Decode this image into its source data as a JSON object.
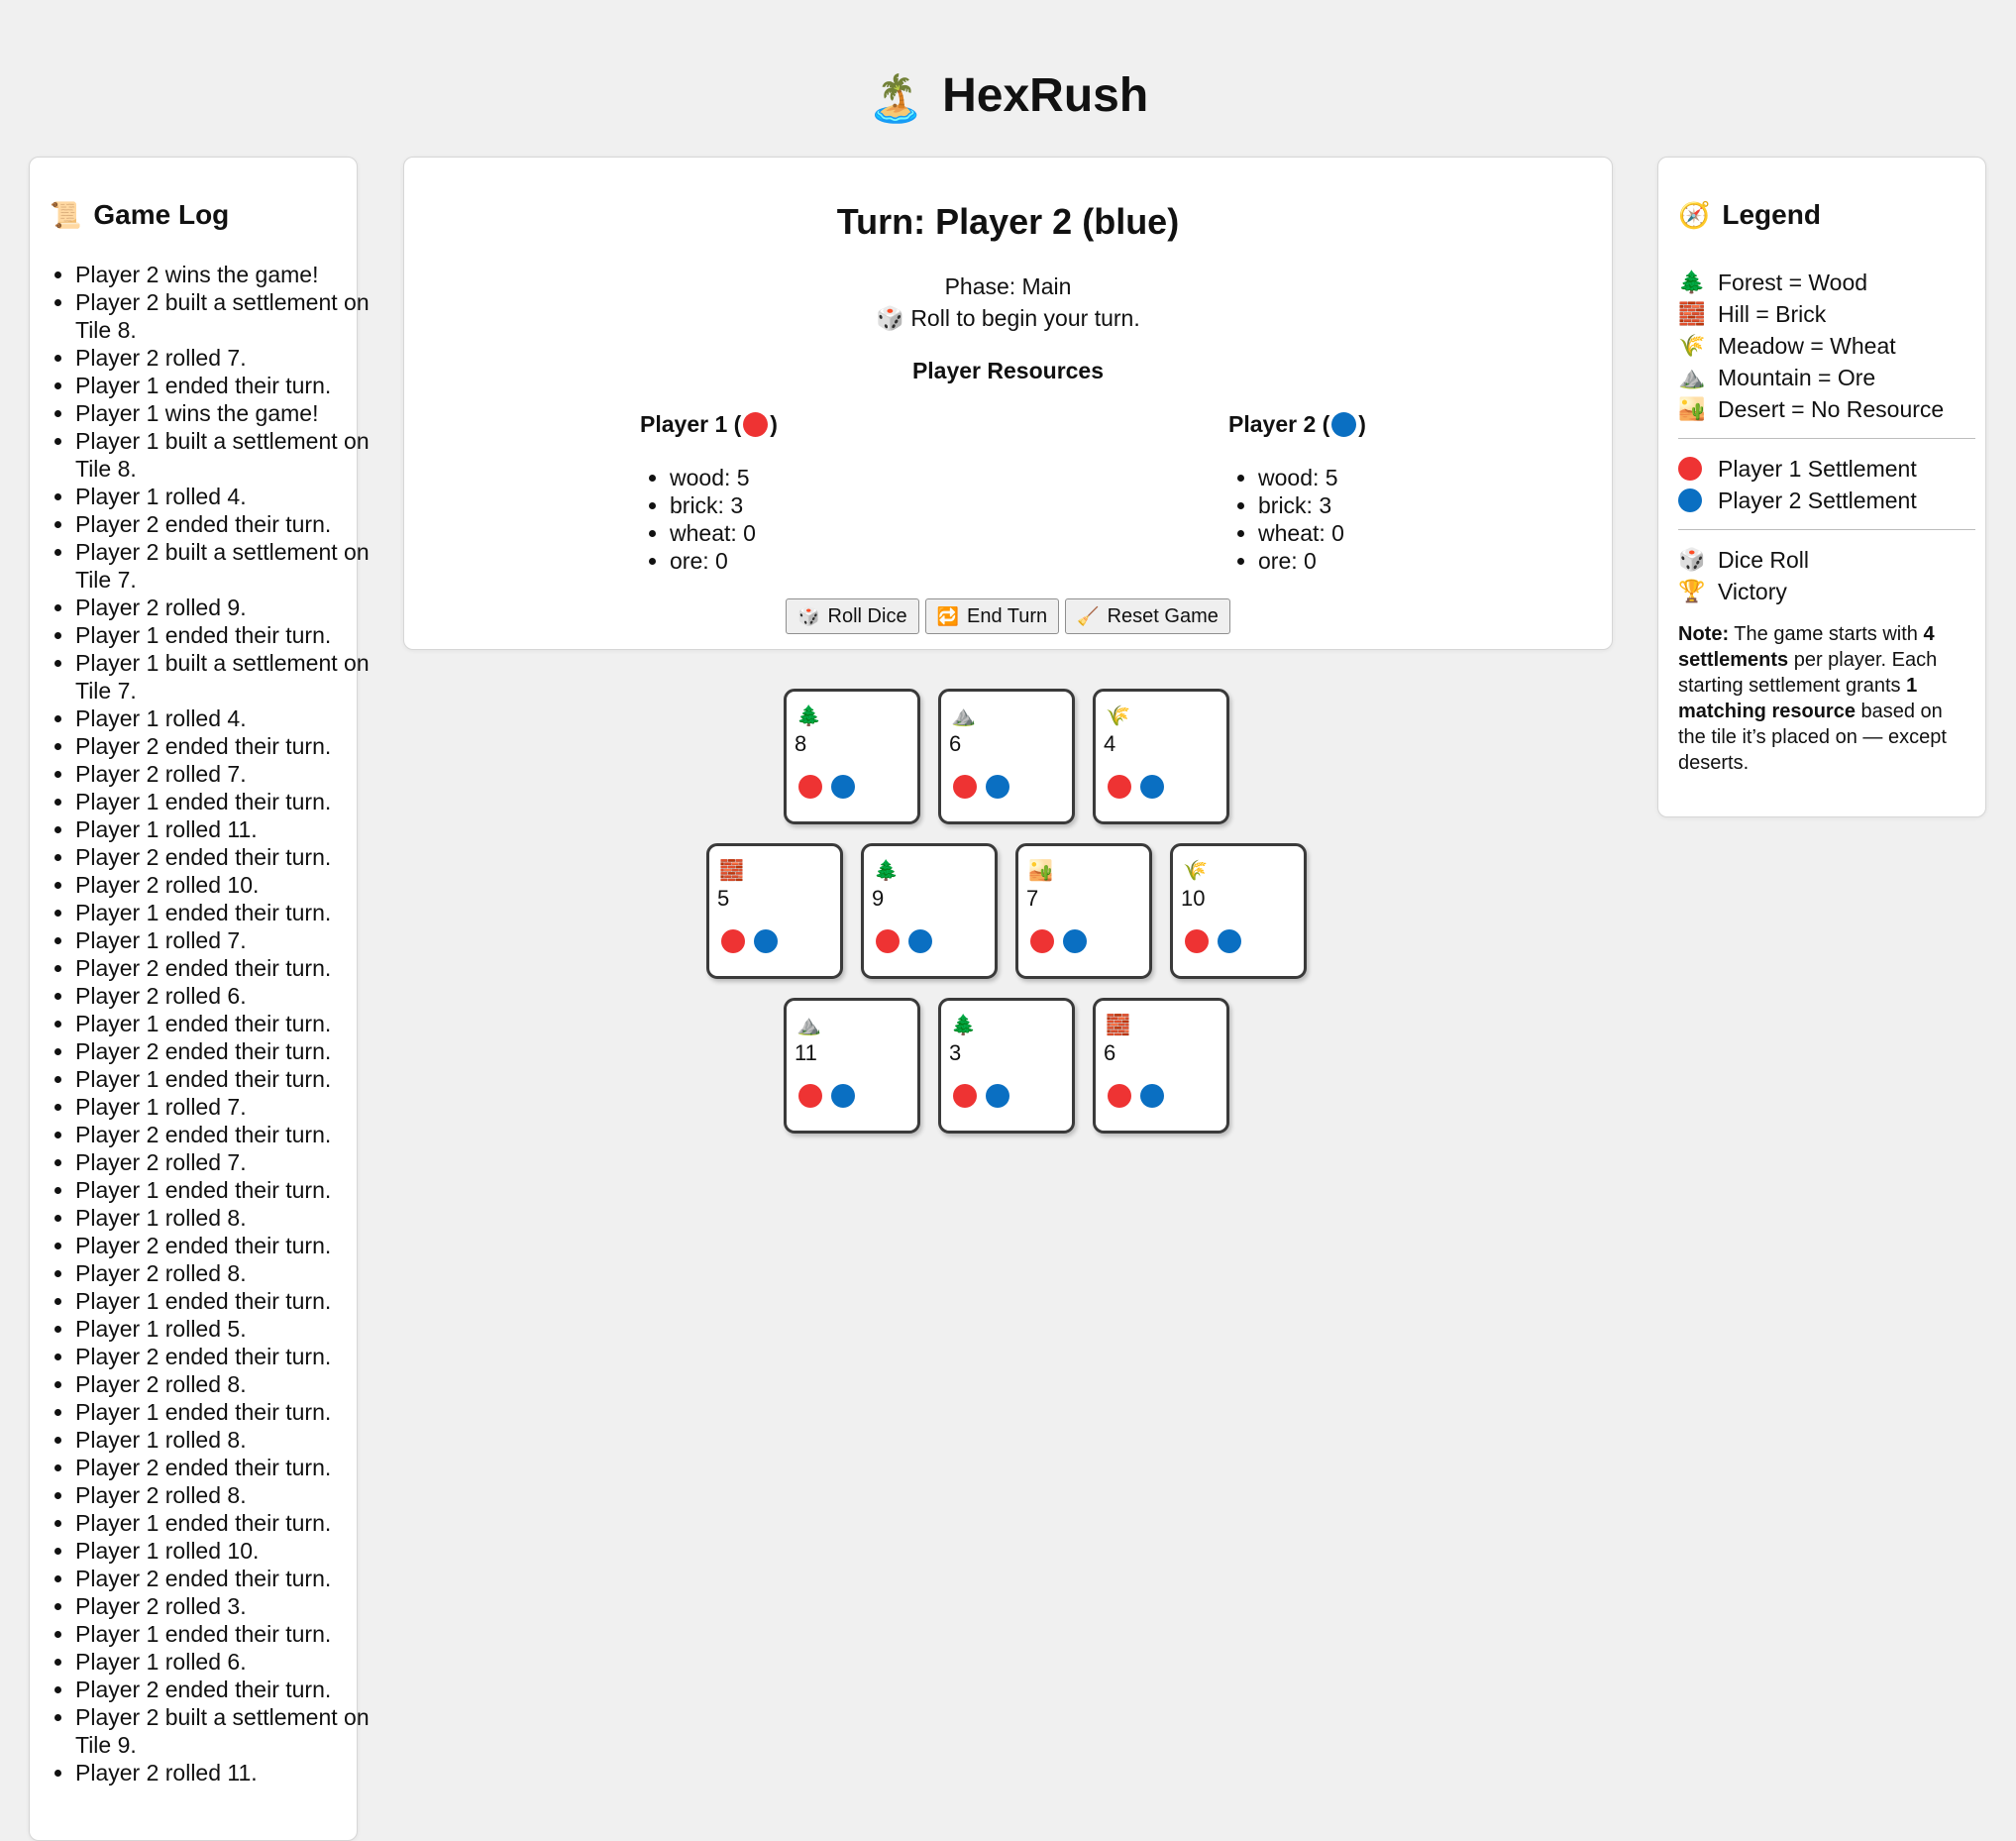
{
  "app": {
    "title": "HexRush",
    "title_icon": "🏝️"
  },
  "colors": {
    "player1": "#ee3333",
    "player2": "#0a6fc2"
  },
  "log": {
    "heading": "Game Log",
    "heading_icon": "📜",
    "entries": [
      "Player 2 wins the game!",
      "Player 2 built a settlement on Tile 8.",
      "Player 2 rolled 7.",
      "Player 1 ended their turn.",
      "Player 1 wins the game!",
      "Player 1 built a settlement on Tile 8.",
      "Player 1 rolled 4.",
      "Player 2 ended their turn.",
      "Player 2 built a settlement on Tile 7.",
      "Player 2 rolled 9.",
      "Player 1 ended their turn.",
      "Player 1 built a settlement on Tile 7.",
      "Player 1 rolled 4.",
      "Player 2 ended their turn.",
      "Player 2 rolled 7.",
      "Player 1 ended their turn.",
      "Player 1 rolled 11.",
      "Player 2 ended their turn.",
      "Player 2 rolled 10.",
      "Player 1 ended their turn.",
      "Player 1 rolled 7.",
      "Player 2 ended their turn.",
      "Player 2 rolled 6.",
      "Player 1 ended their turn.",
      "Player 2 ended their turn.",
      "Player 1 ended their turn.",
      "Player 1 rolled 7.",
      "Player 2 ended their turn.",
      "Player 2 rolled 7.",
      "Player 1 ended their turn.",
      "Player 1 rolled 8.",
      "Player 2 ended their turn.",
      "Player 2 rolled 8.",
      "Player 1 ended their turn.",
      "Player 1 rolled 5.",
      "Player 2 ended their turn.",
      "Player 2 rolled 8.",
      "Player 1 ended their turn.",
      "Player 1 rolled 8.",
      "Player 2 ended their turn.",
      "Player 2 rolled 8.",
      "Player 1 ended their turn.",
      "Player 1 rolled 10.",
      "Player 2 ended their turn.",
      "Player 2 rolled 3.",
      "Player 1 ended their turn.",
      "Player 1 rolled 6.",
      "Player 2 ended their turn.",
      "Player 2 built a settlement on Tile 9.",
      "Player 2 rolled 11."
    ]
  },
  "status": {
    "turn": "Turn: Player 2 (blue)",
    "phase": "Phase: Main",
    "hint_icon": "🎲",
    "hint": "Roll to begin your turn.",
    "resources_heading": "Player Resources",
    "players": [
      {
        "name": "Player 1 (",
        "close": ")",
        "resources": [
          "wood: 5",
          "brick: 3",
          "wheat: 0",
          "ore: 0"
        ]
      },
      {
        "name": "Player 2 (",
        "close": ")",
        "resources": [
          "wood: 5",
          "brick: 3",
          "wheat: 0",
          "ore: 0"
        ]
      }
    ],
    "buttons": {
      "roll": {
        "icon": "🎲",
        "label": "Roll Dice"
      },
      "end": {
        "icon": "🔁",
        "label": "End Turn"
      },
      "reset": {
        "icon": "🧹",
        "label": "Reset Game"
      }
    }
  },
  "legend": {
    "heading": "Legend",
    "heading_icon": "🧭",
    "terrain": [
      {
        "icon": "🌲",
        "label": "Forest = Wood"
      },
      {
        "icon": "🧱",
        "label": "Hill = Brick"
      },
      {
        "icon": "🌾",
        "label": "Meadow = Wheat"
      },
      {
        "icon": "⛰️",
        "label": "Mountain = Ore"
      },
      {
        "icon": "🏜️",
        "label": "Desert = No Resource"
      }
    ],
    "settlements": [
      {
        "label": "Player 1 Settlement"
      },
      {
        "label": "Player 2 Settlement"
      }
    ],
    "misc": [
      {
        "icon": "🎲",
        "label": "Dice Roll"
      },
      {
        "icon": "🏆",
        "label": "Victory"
      }
    ],
    "note": {
      "b1": "Note:",
      "t1": " The game starts with ",
      "b2": "4 settlements",
      "t2": " per player. Each starting settlement grants ",
      "b3": "1 matching resource",
      "t3": " based on the tile it’s placed on — except deserts."
    }
  },
  "board": {
    "tiles": [
      {
        "terrain": "forest",
        "icon": "🌲",
        "number": "8"
      },
      {
        "terrain": "mountain",
        "icon": "⛰️",
        "number": "6"
      },
      {
        "terrain": "meadow",
        "icon": "🌾",
        "number": "4"
      },
      {
        "terrain": "hill",
        "icon": "🧱",
        "number": "5"
      },
      {
        "terrain": "forest",
        "icon": "🌲",
        "number": "9"
      },
      {
        "terrain": "desert",
        "icon": "🏜️",
        "number": "7"
      },
      {
        "terrain": "meadow",
        "icon": "🌾",
        "number": "10"
      },
      {
        "terrain": "mountain",
        "icon": "⛰️",
        "number": "11"
      },
      {
        "terrain": "forest",
        "icon": "🌲",
        "number": "3"
      },
      {
        "terrain": "hill",
        "icon": "🧱",
        "number": "6"
      }
    ]
  }
}
